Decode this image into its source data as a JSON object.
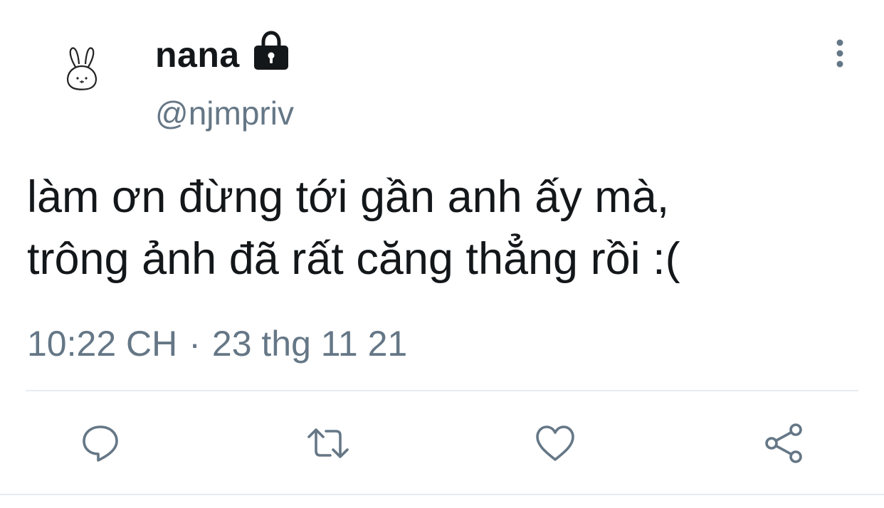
{
  "author": {
    "display_name": "nana",
    "handle": "@njmpriv",
    "avatar_icon": "bunny-avatar-icon",
    "protected_icon": "lock-icon"
  },
  "tweet": {
    "text": "làm ơn đừng tới gần anh ấy mà,\ntrông ảnh đã rất căng thẳng rồi :(",
    "time": "10:22 CH",
    "separator": "·",
    "date": "23 thg 11 21"
  },
  "actions": [
    {
      "name": "reply",
      "icon": "reply-icon"
    },
    {
      "name": "retweet",
      "icon": "retweet-icon"
    },
    {
      "name": "like",
      "icon": "heart-icon"
    },
    {
      "name": "share",
      "icon": "share-icon"
    }
  ],
  "colors": {
    "text": "#14171a",
    "secondary": "#657786",
    "divider": "#e6ecf0"
  }
}
